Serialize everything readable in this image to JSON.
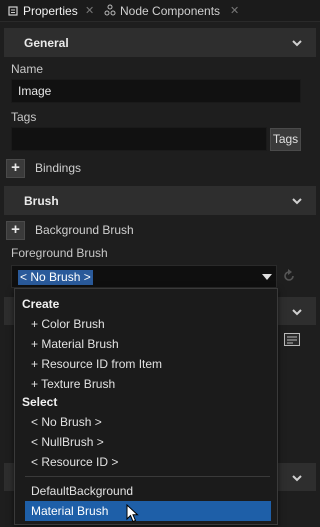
{
  "tabs": [
    {
      "label": "Properties",
      "active": true
    },
    {
      "label": "Node Components",
      "active": false
    }
  ],
  "general": {
    "title": "General",
    "name_label": "Name",
    "name_value": "Image",
    "tags_label": "Tags",
    "tags_value": "",
    "tags_button": "Tags",
    "bindings_label": "Bindings"
  },
  "brush": {
    "title": "Brush",
    "background_label": "Background Brush",
    "foreground_label": "Foreground Brush",
    "foreground_value": "< No Brush >"
  },
  "dropdown": {
    "create_header": "Create",
    "create_items": [
      "+ Color Brush",
      "+ Material Brush",
      "+ Resource ID from Item",
      "+ Texture Brush"
    ],
    "select_header": "Select",
    "select_items": [
      "< No Brush >",
      "< NullBrush >",
      "< Resource ID >"
    ],
    "resource_items": [
      "DefaultBackground",
      "Material Brush"
    ],
    "selected_item": "Material Brush"
  },
  "colors": {
    "background": "#1e1e1e",
    "section": "#2e2e2e",
    "accent": "#1e5fa8"
  }
}
